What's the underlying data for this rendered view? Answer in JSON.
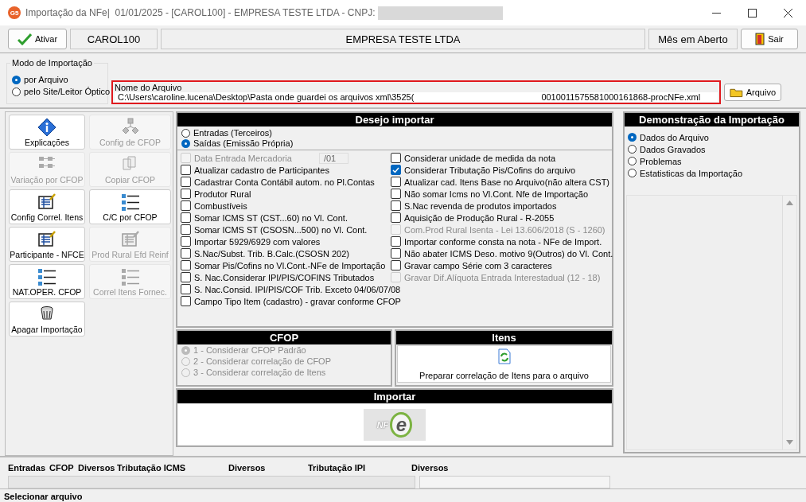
{
  "window": {
    "badge": "G5",
    "title": "Importação da NFe|  01/01/2025 - [CAROL100] - EMPRESA TESTE LTDA - CNPJ: "
  },
  "toolbar": {
    "activate_button": "Ativar",
    "user": "CAROL100",
    "company": "EMPRESA TESTE LTDA",
    "period": "Mês em Aberto",
    "exit_button": "Sair"
  },
  "import_mode": {
    "title": "Modo de Importação",
    "options": [
      {
        "label": "por Arquivo",
        "selected": true
      },
      {
        "label": "pelo Site/Leitor Óptico",
        "selected": false
      }
    ]
  },
  "file": {
    "label": "Nome do Arquivo",
    "path_start": "C:\\Users\\caroline.lucena\\Desktop\\Pasta onde guardei os arquivos xml\\3525(",
    "path_end": "0010011575581000161868-procNFe.xml",
    "button": "Arquivo"
  },
  "side_buttons": [
    {
      "label": "Explicações",
      "kind": "info",
      "disabled": false
    },
    {
      "label": "Config de CFOP",
      "kind": "tree",
      "disabled": true
    },
    {
      "label": "Variação por CFOP",
      "kind": "grid",
      "disabled": true
    },
    {
      "label": "Copiar CFOP",
      "kind": "copy",
      "disabled": true
    },
    {
      "label": "Config Correl. Itens",
      "kind": "form",
      "disabled": false
    },
    {
      "label": "C/C por CFOP",
      "kind": "list",
      "disabled": false
    },
    {
      "label": "Participante - NFCE",
      "kind": "form",
      "disabled": false
    },
    {
      "label": "Prod Rural Efd Reinf",
      "kind": "form",
      "disabled": true
    },
    {
      "label": "NAT.OPER. CFOP",
      "kind": "list",
      "disabled": false
    },
    {
      "label": "Correl Itens Fornec.",
      "kind": "list",
      "disabled": true
    },
    {
      "label": "Apagar Importação",
      "kind": "trash",
      "disabled": false
    }
  ],
  "desejo": {
    "title": "Desejo importar",
    "direction": [
      {
        "label": "Entradas (Terceiros)",
        "selected": false
      },
      {
        "label": "Saídas (Emissão Própria)",
        "selected": true
      }
    ],
    "date_field": {
      "label": "Data Entrada Mercadoria",
      "value": "/01",
      "checked": false,
      "disabled": true
    },
    "left_options": [
      {
        "label": "Atualizar cadastro de Participantes",
        "checked": false,
        "disabled": false
      },
      {
        "label": "Cadastrar Conta Contábil autom. no Pl.Contas",
        "checked": false,
        "disabled": false
      },
      {
        "label": "Produtor Rural",
        "checked": false,
        "disabled": false
      },
      {
        "label": "Combustíveis",
        "checked": false,
        "disabled": false
      },
      {
        "label": "Somar ICMS ST (CST...60) no Vl. Cont.",
        "checked": false,
        "disabled": false
      },
      {
        "label": "Somar ICMS ST (CSOSN...500) no Vl. Cont.",
        "checked": false,
        "disabled": false
      },
      {
        "label": "Importar 5929/6929 com valores",
        "checked": false,
        "disabled": false
      },
      {
        "label": "S.Nac/Subst. Trib. B.Calc.(CSOSN 202)",
        "checked": false,
        "disabled": false
      },
      {
        "label": "Somar Pis/Cofins no Vl.Cont.-NFe de Importação",
        "checked": false,
        "disabled": false
      },
      {
        "label": "S. Nac.Considerar IPI/PIS/COFINS Tributados",
        "checked": false,
        "disabled": false
      },
      {
        "label": "S. Nac.Consid. IPI/PIS/COF Trib. Exceto 04/06/07/08",
        "checked": false,
        "disabled": false
      },
      {
        "label": "Campo Tipo Item (cadastro) - gravar conforme CFOP",
        "checked": false,
        "disabled": false
      }
    ],
    "right_options": [
      {
        "label": "Considerar unidade de medida da nota",
        "checked": false,
        "disabled": false
      },
      {
        "label": "Considerar Tributação Pis/Cofins do arquivo",
        "checked": true,
        "disabled": false
      },
      {
        "label": "Atualizar cad. Itens Base no Arquivo(não altera CST)",
        "checked": false,
        "disabled": false
      },
      {
        "label": "Não somar Icms no Vl.Cont. Nfe de Importação",
        "checked": false,
        "disabled": false
      },
      {
        "label": "S.Nac revenda de produtos importados",
        "checked": false,
        "disabled": false
      },
      {
        "label": "Aquisição de Produção Rural - R-2055",
        "checked": false,
        "disabled": false
      },
      {
        "label": "Com.Prod Rural Isenta - Lei 13.606/2018 (S - 1260)",
        "checked": false,
        "disabled": true
      },
      {
        "label": "Importar conforme consta na nota - NFe de Import.",
        "checked": false,
        "disabled": false
      },
      {
        "label": "Não abater ICMS Deso. motivo 9(Outros) do Vl. Cont.",
        "checked": false,
        "disabled": false
      },
      {
        "label": "Gravar campo Série com 3 caracteres",
        "checked": false,
        "disabled": false
      },
      {
        "label": "Gravar Dif.Alíquota Entrada Interestadual (12 - 18)",
        "checked": false,
        "disabled": true
      }
    ]
  },
  "cfop": {
    "title": "CFOP",
    "options": [
      {
        "label": "1 - Considerar CFOP Padrão",
        "selected": true,
        "disabled": true
      },
      {
        "label": "2 - Considerar correlação de CFOP",
        "selected": false,
        "disabled": true
      },
      {
        "label": "3 - Considerar correlação de Itens",
        "selected": false,
        "disabled": true
      }
    ]
  },
  "itens": {
    "title": "Itens",
    "button": "Preparar correlação de Itens para o arquivo"
  },
  "importar": {
    "title": "Importar",
    "logo": [
      "NF",
      "e"
    ]
  },
  "demo": {
    "title": "Demonstração da Importação",
    "options": [
      {
        "label": "Dados do Arquivo",
        "selected": true
      },
      {
        "label": "Dados Gravados",
        "selected": false
      },
      {
        "label": "Problemas",
        "selected": false
      },
      {
        "label": "Estatisticas da Importação",
        "selected": false
      }
    ]
  },
  "totals": {
    "progress": [
      {
        "level": 0
      },
      {
        "level": 0
      }
    ],
    "columns": [
      "Entradas",
      "CFOP",
      "Diversos",
      "Tributação ICMS",
      "Diversos",
      "Tributação IPI",
      "Diversos"
    ]
  },
  "status_bar": "Selecionar arquivo"
}
